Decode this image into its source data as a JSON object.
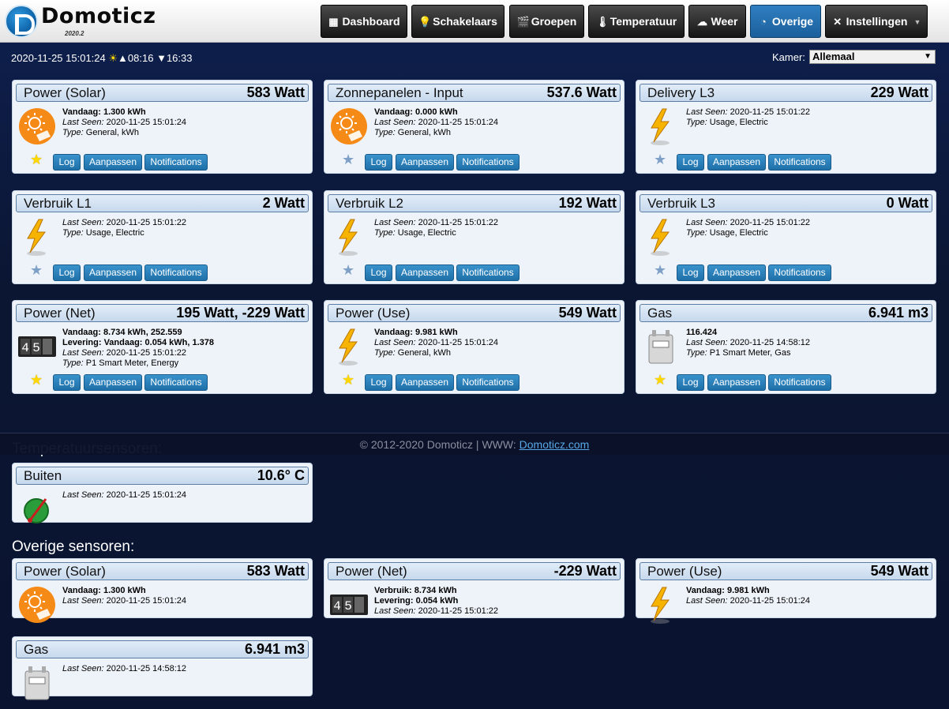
{
  "app": {
    "name": "Domoticz",
    "version": "2020.2"
  },
  "nav": [
    {
      "label": "Dashboard",
      "icon": "dashboard-icon",
      "glyph": "▦",
      "active": false
    },
    {
      "label": "Schakelaars",
      "icon": "bulb-icon",
      "glyph": "💡",
      "active": false
    },
    {
      "label": "Groepen",
      "icon": "clapper-icon",
      "glyph": "🎬",
      "active": false
    },
    {
      "label": "Temperatuur",
      "icon": "thermometer-icon",
      "glyph": "🌡",
      "active": false
    },
    {
      "label": "Weer",
      "icon": "cloud-icon",
      "glyph": "☁",
      "active": false
    },
    {
      "label": "Overige",
      "icon": "gauge-icon",
      "glyph": "◔",
      "active": true
    },
    {
      "label": "Instellingen",
      "icon": "tools-icon",
      "glyph": "✕",
      "active": false
    }
  ],
  "status": {
    "datetime": "2020-11-25 15:01:24",
    "sunrise": "08:16",
    "sunset": "16:33"
  },
  "kamer": {
    "label": "Kamer:",
    "value": "Allemaal"
  },
  "buttons": {
    "log": "Log",
    "edit": "Aanpassen",
    "notifications": "Notifications"
  },
  "cards": [
    {
      "title": "Power (Solar)",
      "value": "583 Watt",
      "icon": "solar-icon",
      "fav": true,
      "lines": [
        {
          "b": "Vandaag: ",
          "t": "1.300 kWh"
        },
        {
          "i": "Last Seen: ",
          "t": "2020-11-25 15:01:24"
        },
        {
          "i": "Type: ",
          "t": "General, kWh"
        }
      ]
    },
    {
      "title": "Zonnepanelen - Input",
      "value": "537.6 Watt",
      "icon": "solar-icon",
      "fav": false,
      "lines": [
        {
          "b": "Vandaag: ",
          "t": "0.000 kWh"
        },
        {
          "i": "Last Seen: ",
          "t": "2020-11-25 15:01:24"
        },
        {
          "i": "Type: ",
          "t": "General, kWh"
        }
      ]
    },
    {
      "title": "Delivery L3",
      "value": "229 Watt",
      "icon": "lightning-icon",
      "fav": false,
      "lines": [
        {
          "i": "Last Seen: ",
          "t": "2020-11-25 15:01:22"
        },
        {
          "i": "Type: ",
          "t": "Usage, Electric"
        }
      ]
    },
    {
      "title": "Verbruik L1",
      "value": "2 Watt",
      "icon": "lightning-icon",
      "fav": false,
      "lines": [
        {
          "i": "Last Seen: ",
          "t": "2020-11-25 15:01:22"
        },
        {
          "i": "Type: ",
          "t": "Usage, Electric"
        }
      ]
    },
    {
      "title": "Verbruik L2",
      "value": "192 Watt",
      "icon": "lightning-icon",
      "fav": false,
      "lines": [
        {
          "i": "Last Seen: ",
          "t": "2020-11-25 15:01:22"
        },
        {
          "i": "Type: ",
          "t": "Usage, Electric"
        }
      ]
    },
    {
      "title": "Verbruik L3",
      "value": "0 Watt",
      "icon": "lightning-icon",
      "fav": false,
      "lines": [
        {
          "i": "Last Seen: ",
          "t": "2020-11-25 15:01:22"
        },
        {
          "i": "Type: ",
          "t": "Usage, Electric"
        }
      ]
    },
    {
      "title": "Power (Net)",
      "value": "195 Watt, -229 Watt",
      "icon": "meter-counter-icon",
      "fav": true,
      "lines": [
        {
          "b": "Vandaag: ",
          "t": "8.734 kWh, 252.559"
        },
        {
          "b": "Levering: Vandaag: ",
          "t": "0.054 kWh, 1.378"
        },
        {
          "i": "Last Seen: ",
          "t": "2020-11-25 15:01:22"
        },
        {
          "i": "Type: ",
          "t": "P1 Smart Meter, Energy"
        }
      ]
    },
    {
      "title": "Power (Use)",
      "value": "549 Watt",
      "icon": "lightning-icon",
      "fav": true,
      "lines": [
        {
          "b": "Vandaag: ",
          "t": "9.981 kWh"
        },
        {
          "i": "Last Seen: ",
          "t": "2020-11-25 15:01:24"
        },
        {
          "i": "Type: ",
          "t": "General, kWh"
        }
      ]
    },
    {
      "title": "Gas",
      "value": "6.941 m3",
      "icon": "gas-meter-icon",
      "fav": true,
      "lines": [
        {
          "b": "",
          "t": "116.424"
        },
        {
          "i": "Last Seen: ",
          "t": "2020-11-25 14:58:12"
        },
        {
          "i": "Type: ",
          "t": "P1 Smart Meter, Gas"
        }
      ]
    }
  ],
  "temp_section": {
    "title": "Temperatuursensoren:"
  },
  "temp_cards": [
    {
      "title": "Buiten",
      "value": "10.6° C",
      "icon": "thermometer-gauge-icon",
      "lines": [
        {
          "i": "Last Seen: ",
          "t": "2020-11-25 15:01:24"
        }
      ]
    }
  ],
  "other_section": {
    "title": "Overige sensoren:"
  },
  "other_cards": [
    {
      "title": "Power (Solar)",
      "value": "583 Watt",
      "icon": "solar-icon",
      "lines": [
        {
          "b": "Vandaag: ",
          "t": "1.300 kWh"
        },
        {
          "i": "Last Seen: ",
          "t": "2020-11-25 15:01:24"
        }
      ]
    },
    {
      "title": "Power (Net)",
      "value": "-229 Watt",
      "icon": "meter-counter-icon",
      "lines": [
        {
          "b": "Verbruik: ",
          "t": "8.734 kWh"
        },
        {
          "b": "Levering: ",
          "t": "0.054 kWh"
        },
        {
          "i": "Last Seen: ",
          "t": "2020-11-25 15:01:22"
        }
      ]
    },
    {
      "title": "Power (Use)",
      "value": "549 Watt",
      "icon": "lightning-icon",
      "lines": [
        {
          "b": "Vandaag: ",
          "t": "9.981 kWh"
        },
        {
          "i": "Last Seen: ",
          "t": "2020-11-25 15:01:24"
        }
      ]
    },
    {
      "title": "Gas",
      "value": "6.941 m3",
      "icon": "gas-meter-icon",
      "lines": [
        {
          "i": "Last Seen: ",
          "t": "2020-11-25 14:58:12"
        }
      ]
    }
  ],
  "footer": {
    "text": "© 2012-2020 Domoticz | WWW: ",
    "link": "Domoticz.com"
  }
}
